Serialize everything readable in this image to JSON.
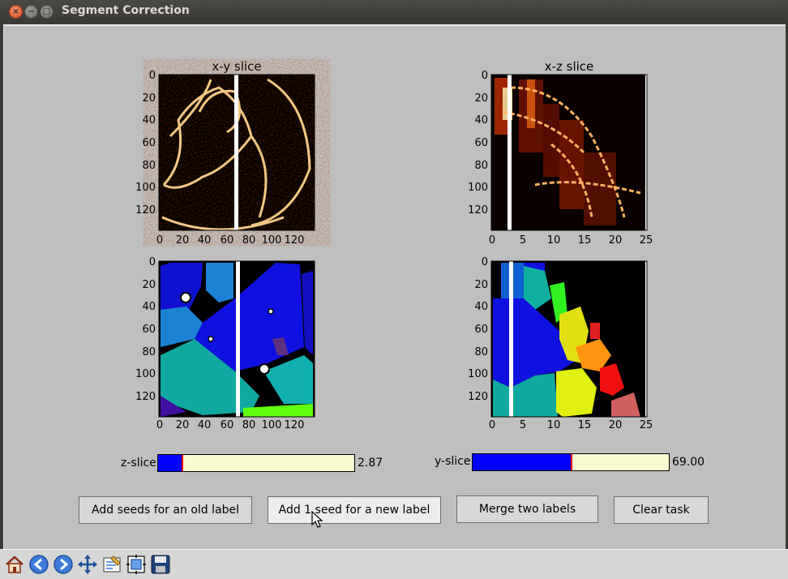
{
  "window": {
    "title": "Segment Correction"
  },
  "plots": {
    "xy_raw": {
      "title": "x-y slice",
      "yticks": [
        "0",
        "20",
        "40",
        "60",
        "80",
        "100",
        "120"
      ],
      "xticks": [
        "0",
        "20",
        "40",
        "60",
        "80",
        "100",
        "120"
      ]
    },
    "xz_raw": {
      "title": "x-z slice",
      "yticks": [
        "0",
        "20",
        "40",
        "60",
        "80",
        "100",
        "120"
      ],
      "xticks": [
        "0",
        "5",
        "10",
        "15",
        "20",
        "25"
      ]
    },
    "xy_labels": {
      "yticks": [
        "0",
        "20",
        "40",
        "60",
        "80",
        "100",
        "120"
      ],
      "xticks": [
        "0",
        "20",
        "40",
        "60",
        "80",
        "100",
        "120"
      ]
    },
    "xz_labels": {
      "yticks": [
        "0",
        "20",
        "40",
        "60",
        "80",
        "100",
        "120"
      ],
      "xticks": [
        "0",
        "5",
        "10",
        "15",
        "20",
        "25"
      ]
    }
  },
  "sliders": {
    "z": {
      "label": "z-slice",
      "value": "2.87",
      "fraction": 0.12
    },
    "y": {
      "label": "y-slice",
      "value": "69.00",
      "fraction": 0.5
    }
  },
  "buttons": {
    "add_old": "Add seeds for an old label",
    "add_new": "Add 1 seed for a new label",
    "merge": "Merge two labels",
    "clear": "Clear task"
  },
  "toolbar": [
    "home-icon",
    "back-icon",
    "forward-icon",
    "pan-icon",
    "configure-icon",
    "subplots-icon",
    "save-icon"
  ]
}
